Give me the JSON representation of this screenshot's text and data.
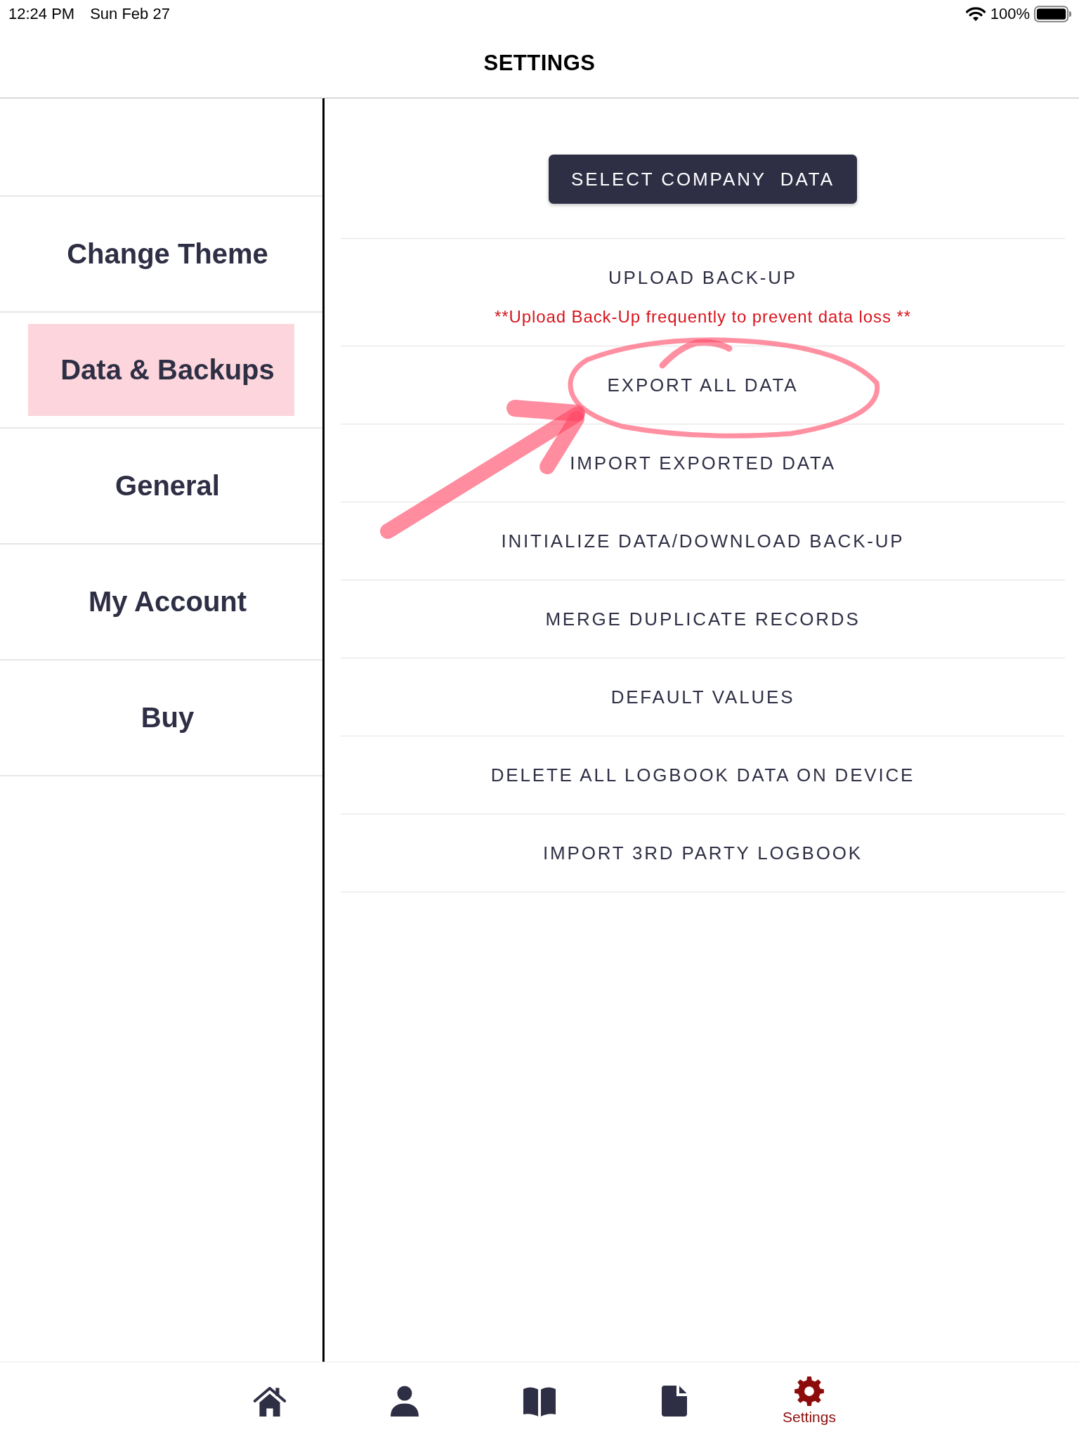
{
  "status_bar": {
    "time": "12:24 PM",
    "date": "Sun Feb 27",
    "battery": "100%"
  },
  "header": {
    "title": "SETTINGS"
  },
  "sidebar": {
    "items": [
      {
        "label": "Change Theme",
        "selected": false
      },
      {
        "label": "Data & Backups",
        "selected": true
      },
      {
        "label": "General",
        "selected": false
      },
      {
        "label": "My Account",
        "selected": false
      },
      {
        "label": "Buy",
        "selected": false
      }
    ]
  },
  "content": {
    "primary_button": "SELECT COMPANY  DATA",
    "rows": [
      {
        "label": "UPLOAD BACK-UP",
        "note": "**Upload Back-Up frequently to prevent data loss **",
        "circled": false
      },
      {
        "label": "EXPORT ALL DATA",
        "circled": true
      },
      {
        "label": "IMPORT EXPORTED DATA",
        "circled": false
      },
      {
        "label": "INITIALIZE DATA/DOWNLOAD BACK-UP",
        "circled": false
      },
      {
        "label": "MERGE DUPLICATE RECORDS",
        "circled": false
      },
      {
        "label": "DEFAULT VALUES",
        "circled": false
      },
      {
        "label": "DELETE ALL LOGBOOK DATA ON DEVICE",
        "circled": false
      },
      {
        "label": "IMPORT 3RD PARTY LOGBOOK",
        "circled": false
      }
    ]
  },
  "tab_bar": {
    "items": [
      {
        "kind": "home",
        "selected": false
      },
      {
        "kind": "person",
        "selected": false
      },
      {
        "kind": "book",
        "selected": false
      },
      {
        "kind": "document",
        "selected": false
      },
      {
        "kind": "gear",
        "label": "Settings",
        "selected": true
      }
    ]
  }
}
